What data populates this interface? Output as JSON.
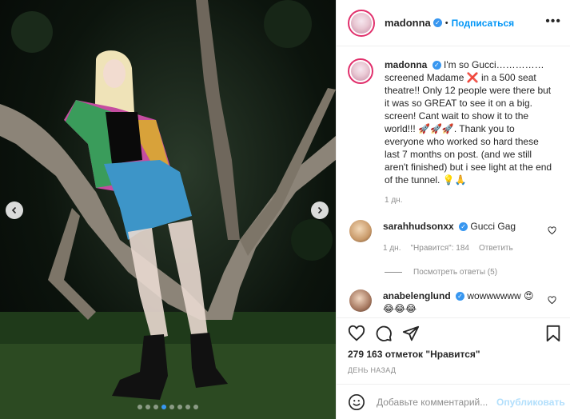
{
  "header": {
    "username": "madonna",
    "separator": "•",
    "follow_label": "Подписаться",
    "more_label": "•••"
  },
  "caption": {
    "username": "madonna",
    "text": "I'm so Gucci……………screened Madame ❌ in a 500 seat theatre!! Only 12 people were there but it was so GREAT to see it on a big. screen! Cant wait to show it to the world!!! 🚀🚀🚀. Thank you to everyone who worked so hard these last 7 months on post. (and we still aren't finished) but i see light at the end of the tunnel. 💡🙏",
    "age": "1 дн."
  },
  "comments": [
    {
      "username": "sarahhudsonxx",
      "text": "Gucci Gag",
      "age": "1 дн.",
      "likes": "\"Нравится\": 184",
      "reply_label": "Ответить",
      "view_replies": "Посмотреть ответы (5)"
    },
    {
      "username": "anabelenglund",
      "text": "wowwwwww 😍",
      "extra": "😂😂😂"
    }
  ],
  "actions": {
    "like_icon": "heart-icon",
    "comment_icon": "comment-icon",
    "share_icon": "share-icon",
    "save_icon": "bookmark-icon"
  },
  "likes_text": "279 163 отметок \"Нравится\"",
  "date_text": "ДЕНЬ НАЗАД",
  "add_comment": {
    "placeholder": "Добавьте комментарий...",
    "publish_label": "Опубликовать"
  },
  "carousel": {
    "total_slides": 8,
    "active_slide": 4
  },
  "colors": {
    "accent": "#0095f6",
    "verified": "#3897f0",
    "muted": "#8e8e8e",
    "publish_disabled": "#b2dffc"
  }
}
